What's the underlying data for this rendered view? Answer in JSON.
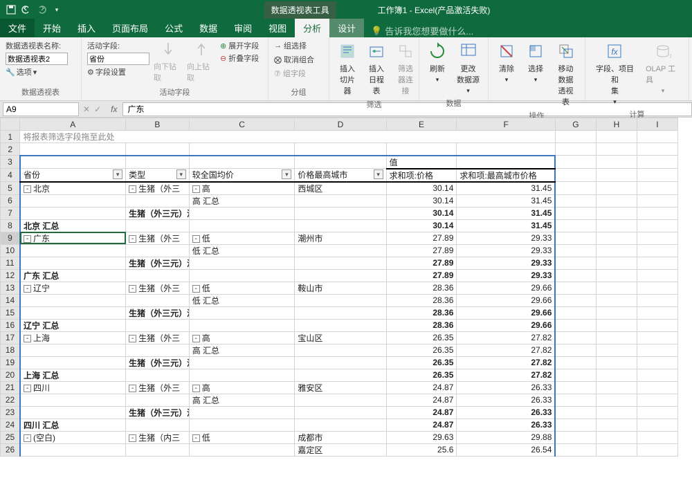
{
  "title": {
    "context_tab": "数据透视表工具",
    "doc": "工作簿1 - Excel(产品激活失败)"
  },
  "tabs": {
    "file": "文件",
    "home": "开始",
    "insert": "插入",
    "layout": "页面布局",
    "formulas": "公式",
    "data": "数据",
    "review": "审阅",
    "view": "视图",
    "analyze": "分析",
    "design": "设计",
    "tell": "告诉我您想要做什么..."
  },
  "ribbon": {
    "g_pivot": "数据透视表",
    "pivot_name_label": "数据透视表名称:",
    "pivot_name": "数据透视表2",
    "options": "选项",
    "g_field": "活动字段",
    "active_label": "活动字段:",
    "active": "省份",
    "field_settings": "字段设置",
    "drilldown": "向下钻取",
    "drillup": "向上钻取",
    "expand": "展开字段",
    "collapse": "折叠字段",
    "g_group": "分组",
    "group_sel": "组选择",
    "ungroup": "取消组合",
    "group_field": "组字段",
    "g_filter": "筛选",
    "slicer": "插入\n切片器",
    "timeline": "插入\n日程表",
    "conn": "筛选\n器连接",
    "g_data": "数据",
    "refresh": "刷新",
    "change_src": "更改\n数据源",
    "g_actions": "操作",
    "clear": "清除",
    "select": "选择",
    "move": "移动\n数据透视表",
    "g_calc": "计算",
    "fields": "字段、项目和\n集",
    "olap": "OLAP 工具"
  },
  "cellref": "A9",
  "formula": "广东",
  "cols": [
    "A",
    "B",
    "C",
    "D",
    "E",
    "F",
    "G",
    "H",
    "I"
  ],
  "filter_drop": "将报表筛选字段拖至此处",
  "headers": {
    "value": "值",
    "province": "省份",
    "type": "类型",
    "vs_avg": "较全国均价",
    "top_city": "价格最高城市",
    "sum_price": "求和项:价格",
    "sum_top": "求和项:最高城市价格"
  },
  "rows": [
    {
      "n": 5,
      "a": "北京",
      "b": "生猪（外三",
      "c": "高",
      "d": "西城区",
      "e": "30.14",
      "f": "31.45",
      "tg_a": true,
      "tg_b": true,
      "tg_c": true
    },
    {
      "n": 6,
      "c": "高 汇总",
      "e": "30.14",
      "f": "31.45"
    },
    {
      "n": 7,
      "b": "生猪（外三元）汇总",
      "e": "30.14",
      "f": "31.45",
      "bold": true
    },
    {
      "n": 8,
      "a": "北京 汇总",
      "e": "30.14",
      "f": "31.45",
      "bold": true
    },
    {
      "n": 9,
      "a": "广东",
      "b": "生猪（外三",
      "c": "低",
      "d": "潮州市",
      "e": "27.89",
      "f": "29.33",
      "tg_a": true,
      "tg_b": true,
      "tg_c": true,
      "sel": true
    },
    {
      "n": 10,
      "c": "低 汇总",
      "e": "27.89",
      "f": "29.33"
    },
    {
      "n": 11,
      "b": "生猪（外三元）汇总",
      "e": "27.89",
      "f": "29.33",
      "bold": true
    },
    {
      "n": 12,
      "a": "广东 汇总",
      "e": "27.89",
      "f": "29.33",
      "bold": true
    },
    {
      "n": 13,
      "a": "辽宁",
      "b": "生猪（外三",
      "c": "低",
      "d": "鞍山市",
      "e": "28.36",
      "f": "29.66",
      "tg_a": true,
      "tg_b": true,
      "tg_c": true
    },
    {
      "n": 14,
      "c": "低 汇总",
      "e": "28.36",
      "f": "29.66"
    },
    {
      "n": 15,
      "b": "生猪（外三元）汇总",
      "e": "28.36",
      "f": "29.66",
      "bold": true
    },
    {
      "n": 16,
      "a": "辽宁 汇总",
      "e": "28.36",
      "f": "29.66",
      "bold": true
    },
    {
      "n": 17,
      "a": "上海",
      "b": "生猪（外三",
      "c": "高",
      "d": "宝山区",
      "e": "26.35",
      "f": "27.82",
      "tg_a": true,
      "tg_b": true,
      "tg_c": true
    },
    {
      "n": 18,
      "c": "高 汇总",
      "e": "26.35",
      "f": "27.82"
    },
    {
      "n": 19,
      "b": "生猪（外三元）汇总",
      "e": "26.35",
      "f": "27.82",
      "bold": true
    },
    {
      "n": 20,
      "a": "上海 汇总",
      "e": "26.35",
      "f": "27.82",
      "bold": true
    },
    {
      "n": 21,
      "a": "四川",
      "b": "生猪（外三",
      "c": "高",
      "d": "雅安区",
      "e": "24.87",
      "f": "26.33",
      "tg_a": true,
      "tg_b": true,
      "tg_c": true
    },
    {
      "n": 22,
      "c": "高 汇总",
      "e": "24.87",
      "f": "26.33"
    },
    {
      "n": 23,
      "b": "生猪（外三元）汇总",
      "e": "24.87",
      "f": "26.33",
      "bold": true
    },
    {
      "n": 24,
      "a": "四川 汇总",
      "e": "24.87",
      "f": "26.33",
      "bold": true
    },
    {
      "n": 25,
      "a": "(空白)",
      "b": "生猪（内三",
      "c": "低",
      "d": "成都市",
      "e": "29.63",
      "f": "29.88",
      "tg_a": true,
      "tg_b": true,
      "tg_c": true
    },
    {
      "n": 26,
      "d": "嘉定区",
      "e": "25.6",
      "f": "26.54"
    }
  ]
}
